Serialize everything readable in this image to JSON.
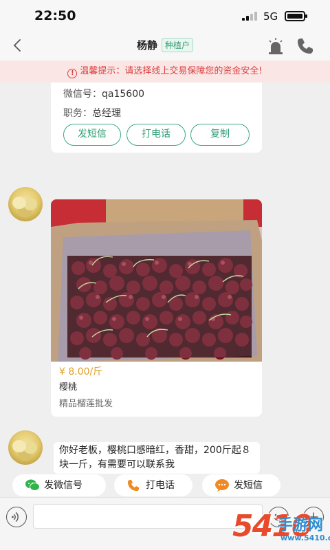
{
  "status_bar": {
    "time": "22:50",
    "network": "5G"
  },
  "nav": {
    "title": "杨静",
    "tag": "种植户"
  },
  "notice": {
    "icon_text": "!",
    "text": "温馨提示：请选择线上交易保障您的资金安全!"
  },
  "contact_card": {
    "wechat_key": "微信号：",
    "wechat_value": "qa15600",
    "position_key": "职务：",
    "position_value": "总经理",
    "buttons": {
      "sms": "发短信",
      "call": "打电话",
      "copy": "复制"
    }
  },
  "product_card": {
    "price": "¥ 8.00/斤",
    "name": "樱桃",
    "description": "精品榴莲批发"
  },
  "message": {
    "text": "你好老板，樱桃口感暗红，香甜，200斤起８块一斤，有需要可以联系我"
  },
  "quick_actions": {
    "wechat": "发微信号",
    "call": "打电话",
    "sms": "发短信"
  },
  "input": {
    "placeholder": ""
  },
  "watermark": {
    "number": "5410",
    "name": "手游网",
    "url": "www.5410.cn"
  },
  "colors": {
    "accent": "#2e9d73",
    "warning": "#d94040",
    "price": "#e0a028"
  }
}
